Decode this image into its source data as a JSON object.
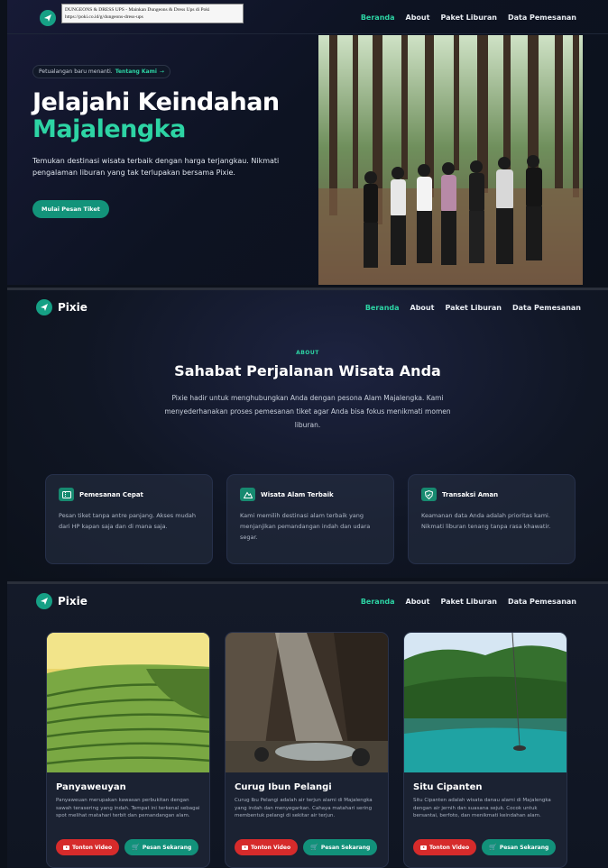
{
  "tooltip": {
    "line1": "DUNGEONS & DRESS UPS - Mainkan Dungeons & Dress Ups di Poki",
    "line2": "https://poki.co.id/g/dungeons-dress-ups"
  },
  "nav": {
    "home": "Beranda",
    "about": "About",
    "packages": "Paket Liburan",
    "orders": "Data Pemesanan"
  },
  "brand": "Pixie",
  "hero": {
    "pill_text": "Petualangan baru menanti.",
    "pill_link": "Tentang Kami",
    "pill_arrow": "→",
    "title_line1": "Jelajahi Keindahan",
    "title_line2": "Majalengka",
    "lead": "Temukan destinasi wisata terbaik dengan harga terjangkau. Nikmati pengalaman liburan yang tak terlupakan bersama Pixie.",
    "cta": "Mulai Pesan Tiket"
  },
  "about": {
    "eyebrow": "ABOUT",
    "title": "Sahabat Perjalanan Wisata Anda",
    "subtitle": "Pixie hadir untuk menghubungkan Anda dengan pesona Alam Majalengka. Kami menyederhanakan proses pemesanan tiket agar Anda bisa fokus menikmati momen liburan.",
    "features": [
      {
        "icon": "ticket-icon",
        "title": "Pemesanan Cepat",
        "text": "Pesan tiket tanpa antre panjang. Akses mudah dari HP kapan saja dan di mana saja."
      },
      {
        "icon": "mountain-icon",
        "title": "Wisata Alam Terbaik",
        "text": "Kami memilih destinasi alam terbaik yang menjanjikan pemandangan indah dan udara segar."
      },
      {
        "icon": "shield-icon",
        "title": "Transaksi Aman",
        "text": "Keamanan data Anda adalah prioritas kami. Nikmati liburan tenang tanpa rasa khawatir."
      }
    ]
  },
  "destinations": [
    {
      "name": "Panyaweuyan",
      "desc": "Panyaweuan merupakan kawasan perbukitan dengan sawah terasering yang indah. Tempat ini terkenal sebagai spot melihat matahari terbit dan pemandangan alam.",
      "video": "Tonton Video",
      "book": "Pesan Sekarang"
    },
    {
      "name": "Curug Ibun Pelangi",
      "desc": "Curug Ibu Pelangi adalah air terjun alami di Majalengka yang indah dan menyegarkan. Cahaya matahari sering membentuk pelangi di sekitar air terjun.",
      "video": "Tonton Video",
      "book": "Pesan Sekarang"
    },
    {
      "name": "Situ Cipanten",
      "desc": "Situ Cipanten adalah wisata danau alami di Majalengka dengan air jernih dan suasana sejuk. Cocok untuk bersantai, berfoto, dan menikmati keindahan alam.",
      "video": "Tonton Video",
      "book": "Pesan Sekarang"
    }
  ],
  "colors": {
    "accent": "#2dd4a4",
    "button": "#13937a",
    "danger": "#d62b2b",
    "bg": "#0c111b"
  }
}
